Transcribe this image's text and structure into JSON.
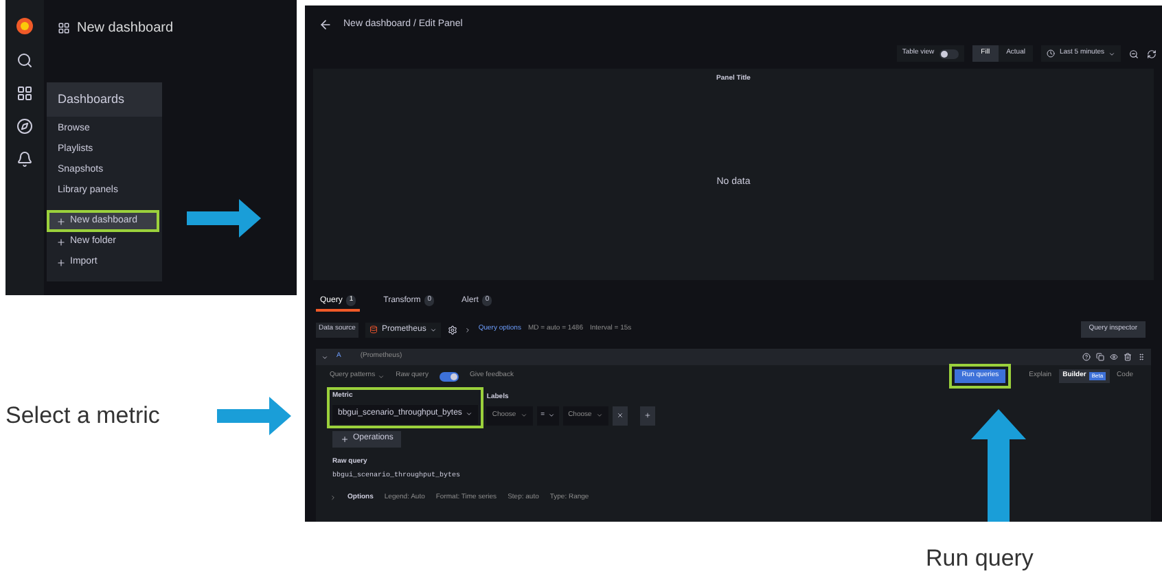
{
  "sidebar_screenshot": {
    "title": "New dashboard",
    "menu": {
      "title": "Dashboards",
      "items": [
        {
          "label": "Browse"
        },
        {
          "label": "Playlists"
        },
        {
          "label": "Snapshots"
        },
        {
          "label": "Library panels"
        }
      ],
      "actions": [
        {
          "label": "New dashboard",
          "highlighted": true
        },
        {
          "label": "New folder",
          "highlighted": false
        },
        {
          "label": "Import",
          "highlighted": false
        }
      ]
    }
  },
  "editor_screenshot": {
    "title": "New dashboard / Edit Panel",
    "toolbar": {
      "table_view": {
        "label": "Table view",
        "on": false
      },
      "view_modes": [
        {
          "label": "Fill",
          "selected": true
        },
        {
          "label": "Actual",
          "selected": false
        }
      ],
      "time_range": "Last 5 minutes"
    },
    "panel": {
      "title": "Panel Title",
      "message": "No data"
    },
    "tabs": [
      {
        "label": "Query",
        "count": "1",
        "selected": true
      },
      {
        "label": "Transform",
        "count": "0",
        "selected": false
      },
      {
        "label": "Alert",
        "count": "0",
        "selected": false
      }
    ],
    "data_source": {
      "label": "Data source",
      "value": "Prometheus",
      "query_options": "Query options",
      "md": "MD = auto = 1486",
      "interval": "Interval = 15s",
      "inspector": "Query inspector"
    },
    "query": {
      "letter": "A",
      "source": "(Prometheus)",
      "query_patterns": "Query patterns",
      "raw_query_toggle": {
        "label": "Raw query",
        "on": true
      },
      "feedback": "Give feedback",
      "run": {
        "label": "Run queries",
        "highlighted": true
      },
      "modes": [
        {
          "label": "Explain",
          "selected": false
        },
        {
          "label": "Builder",
          "selected": true,
          "badge": "Beta"
        },
        {
          "label": "Code",
          "selected": false
        }
      ],
      "metric": {
        "label": "Metric",
        "value": "bbgui_scenario_throughput_bytes",
        "highlighted": true
      },
      "labels": {
        "label": "Labels",
        "name": "Choose",
        "operator": "=",
        "value": "Choose"
      },
      "operations": "Operations",
      "raw_query": {
        "label": "Raw query",
        "value": "bbgui_scenario_throughput_bytes"
      },
      "options": {
        "label": "Options",
        "items": [
          "Legend: Auto",
          "Format: Time series",
          "Step: auto",
          "Type: Range"
        ]
      }
    }
  },
  "annotations": [
    {
      "text": "Select a metric"
    },
    {
      "text": "Run query"
    }
  ]
}
